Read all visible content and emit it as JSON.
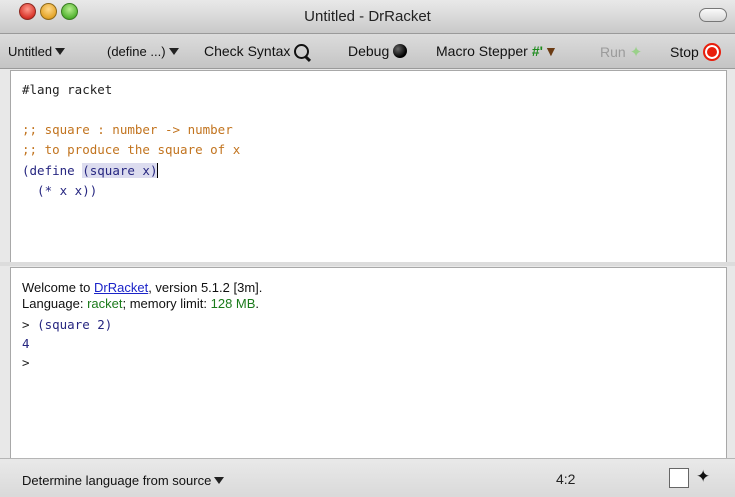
{
  "window": {
    "title": "Untitled - DrRacket"
  },
  "toolbar": {
    "file_menu": "Untitled",
    "define_menu": "(define ...)",
    "check_syntax": "Check Syntax",
    "debug": "Debug",
    "macro_stepper": "Macro Stepper",
    "run": "Run",
    "stop": "Stop",
    "hash_symbol": "#'",
    "icons": [
      "magnifier-icon",
      "bomb-icon",
      "torch-icon",
      "runner-icon",
      "stop-icon"
    ]
  },
  "definitions": {
    "lines": [
      "#lang racket",
      "",
      ";; square : number -> number",
      ";; to produce the square of x",
      "(define ",
      "  (* x x))"
    ],
    "highlighted": "(square x)"
  },
  "interactions": {
    "welcome_prefix": "Welcome to ",
    "app_link": "DrRacket",
    "welcome_suffix": ", version 5.1.2 [3m].",
    "language_prefix": "Language: ",
    "language": "racket",
    "memory_prefix": "; memory limit: ",
    "memory": "128 MB",
    "memory_suffix": ".",
    "prompt": ">",
    "input": "(square 2)",
    "output": "4"
  },
  "statusbar": {
    "language_menu": "Determine language from source",
    "position": "4:2"
  },
  "colors": {
    "comment": "#c2741f",
    "code": "#262680",
    "link": "#1b24c8",
    "green": "#1a7a1a",
    "stop": "#e81e0c"
  }
}
